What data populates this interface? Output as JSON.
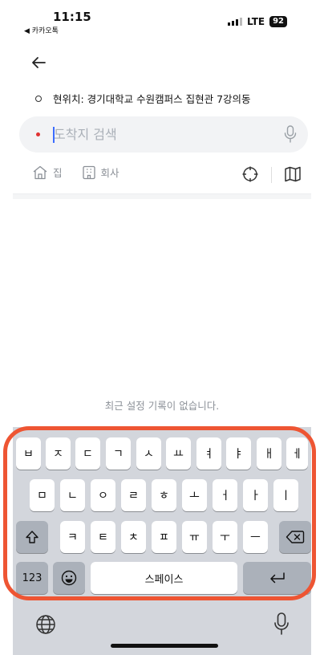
{
  "status": {
    "time": "11:15",
    "back_app": "◀ 카카오톡",
    "network": "LTE",
    "battery": "92"
  },
  "header": {
    "current_location": "현위치: 경기대학교 수원캠퍼스 집현관 7강의동"
  },
  "search": {
    "placeholder": "도착지 검색",
    "value": ""
  },
  "quick": {
    "home_label": "집",
    "company_label": "회사"
  },
  "empty_message": "최근 설정 기록이 없습니다.",
  "keyboard": {
    "row1": [
      "ㅂ",
      "ㅈ",
      "ㄷ",
      "ㄱ",
      "ㅅ",
      "ㅛ",
      "ㅕ",
      "ㅑ",
      "ㅐ",
      "ㅔ"
    ],
    "row2": [
      "ㅁ",
      "ㄴ",
      "ㅇ",
      "ㄹ",
      "ㅎ",
      "ㅗ",
      "ㅓ",
      "ㅏ",
      "ㅣ"
    ],
    "row3": [
      "ㅋ",
      "ㅌ",
      "ㅊ",
      "ㅍ",
      "ㅠ",
      "ㅜ",
      "ㅡ"
    ],
    "numbers_label": "123",
    "space_label": "스페이스"
  },
  "colors": {
    "highlight": "#ee5533",
    "accent_dot": "#e03131",
    "caret": "#3b6cff"
  }
}
